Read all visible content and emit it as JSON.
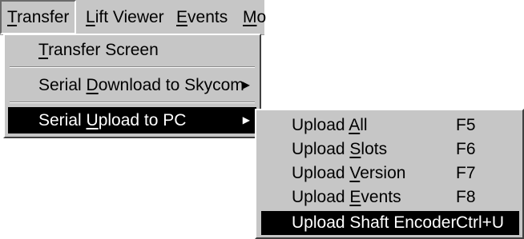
{
  "menubar": {
    "items": [
      {
        "label": "Transfer",
        "accel_index": 0
      },
      {
        "label": "Lift Viewer",
        "accel_index": 0
      },
      {
        "label": "Events",
        "accel_index": 0
      },
      {
        "label": "Mo",
        "accel_index": 0
      }
    ]
  },
  "transfer_menu": {
    "items": [
      {
        "label": "Transfer Screen",
        "accel": "T"
      },
      {
        "label": "Serial Download to Skycom",
        "accel": "D",
        "has_submenu": true
      },
      {
        "label": "Serial Upload to PC",
        "accel": "U",
        "has_submenu": true,
        "highlighted": true
      }
    ],
    "submenu_arrow": "▶"
  },
  "upload_submenu": {
    "items": [
      {
        "label": "Upload All",
        "shortcut": "F5"
      },
      {
        "label": "Upload Slots",
        "shortcut": "F6"
      },
      {
        "label": "Upload Version",
        "shortcut": "F7"
      },
      {
        "label": "Upload Events",
        "shortcut": "F8"
      },
      {
        "label": "Upload Shaft Encoder",
        "shortcut": "Ctrl+U",
        "highlighted": true
      }
    ]
  },
  "colors": {
    "menu_bg": "#c6c6c6",
    "highlight_bg": "#000000",
    "highlight_text": "#ffffff"
  }
}
